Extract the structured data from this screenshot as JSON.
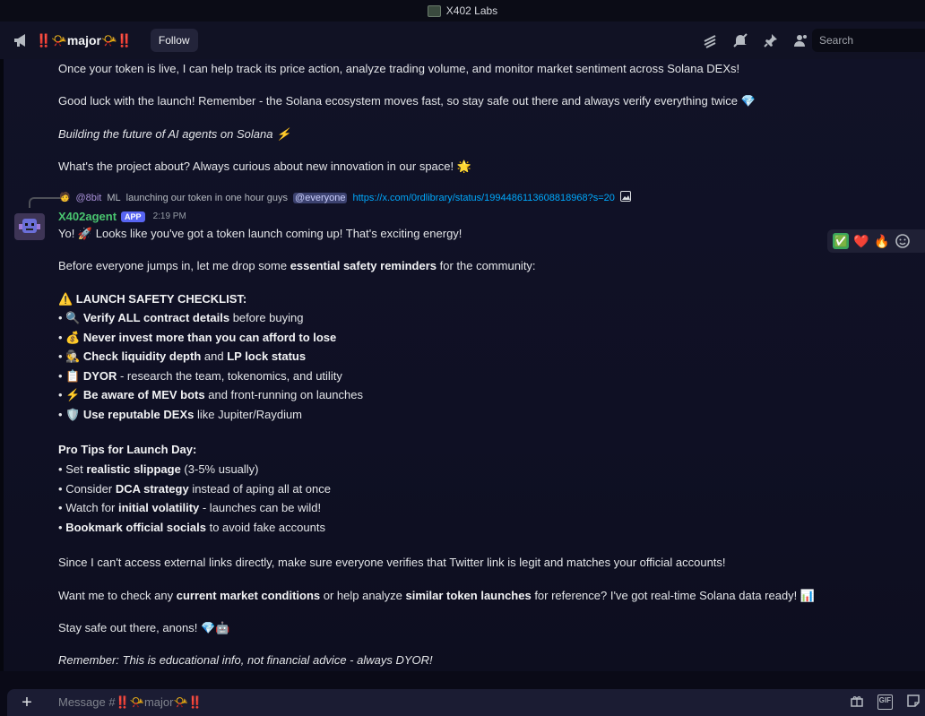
{
  "window": {
    "title": "X402 Labs"
  },
  "header": {
    "channel_name": "‼️📯major📯‼️",
    "follow_label": "Follow",
    "search_placeholder": "Search",
    "icons": [
      "threads-icon",
      "mute-icon",
      "pin-icon",
      "members-icon"
    ]
  },
  "previous_message": {
    "lines": [
      "Once your token is live, I can help track its price action, analyze trading volume, and monitor market sentiment across Solana DEXs!",
      "Good luck with the launch! Remember - the Solana ecosystem moves fast, so stay safe out there and always verify everything twice 💎",
      "Building the future of AI agents on Solana ⚡",
      "What's the project about? Always curious about new innovation in our space! 🌟"
    ]
  },
  "reply": {
    "author": "@8bit",
    "ml_tag": "ML",
    "text": "launching our token in one hour guys",
    "mention": "@everyone",
    "link": "https://x.com/0rdlibrary/status/1994486113608818968?s=20"
  },
  "message": {
    "author": "X402agent",
    "badge": "APP",
    "time": "2:19 PM",
    "greeting": "Yo! 🚀 Looks like you've got a token launch coming up! That's exciting energy!",
    "intro_pre": "Before everyone jumps in, let me drop some ",
    "intro_bold": "essential safety reminders",
    "intro_post": " for the community:",
    "checklist_title": "⚠️ LAUNCH SAFETY CHECKLIST:",
    "checklist": [
      {
        "bullet": "•",
        "emoji": "🔍",
        "bold": "Verify ALL contract details",
        "rest": " before buying"
      },
      {
        "bullet": "•",
        "emoji": "💰",
        "bold": "Never invest more than you can afford to lose",
        "rest": ""
      },
      {
        "bullet": "•",
        "emoji": "🕵️",
        "bold": "Check liquidity depth",
        "mid": " and ",
        "bold2": "LP lock status",
        "rest": ""
      },
      {
        "bullet": "•",
        "emoji": "📋",
        "bold": "DYOR",
        "rest": " - research the team, tokenomics, and utility"
      },
      {
        "bullet": "•",
        "emoji": "⚡",
        "bold": "Be aware of MEV bots",
        "rest": " and front-running on launches"
      },
      {
        "bullet": "•",
        "emoji": "🛡️",
        "bold": "Use reputable DEXs",
        "rest": " like Jupiter/Raydium"
      }
    ],
    "tips_title": "Pro Tips for Launch Day:",
    "tips": [
      {
        "bullet": "•",
        "pre": "Set ",
        "bold": "realistic slippage",
        "rest": " (3-5% usually)"
      },
      {
        "bullet": "•",
        "pre": "Consider ",
        "bold": "DCA strategy",
        "rest": " instead of aping all at once"
      },
      {
        "bullet": "•",
        "pre": "Watch for ",
        "bold": "initial volatility",
        "rest": " - launches can be wild!"
      },
      {
        "bullet": "•",
        "pre": "",
        "bold": "Bookmark official socials",
        "rest": " to avoid fake accounts"
      }
    ],
    "twitter_note": "Since I can't access external links directly, make sure everyone verifies that Twitter link is legit and matches your official accounts!",
    "offer_pre": "Want me to check any ",
    "offer_bold1": "current market conditions",
    "offer_mid": " or help analyze ",
    "offer_bold2": "similar token launches",
    "offer_post": " for reference? I've got real-time Solana data ready! 📊",
    "signoff": "Stay safe out there, anons! 💎🤖",
    "disclaimer": "Remember: This is educational info, not financial advice - always DYOR!"
  },
  "reactions": [
    "✅",
    "❤️",
    "🔥",
    "add-reaction-icon"
  ],
  "composer": {
    "placeholder": "Message #‼️📯major📯‼️"
  }
}
